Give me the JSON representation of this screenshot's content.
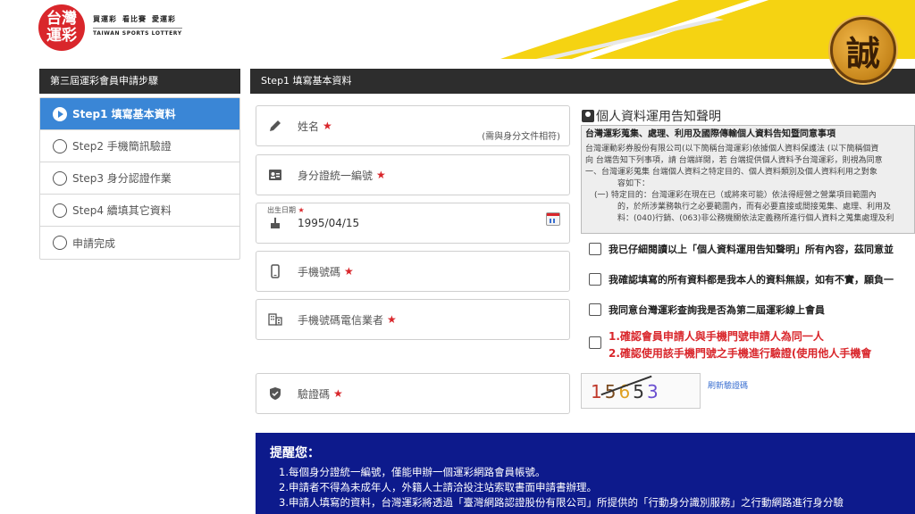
{
  "header": {
    "logo_text": "台灣運彩",
    "slogan": [
      "買運彩",
      "看比賽",
      "愛運彩"
    ],
    "logo_en": "TAIWAN SPORTS LOTTERY",
    "badge": "誠"
  },
  "sidebar": {
    "title": "第三屆運彩會員申請步驟",
    "steps": [
      {
        "label": "Step1 填寫基本資料",
        "active": true
      },
      {
        "label": "Step2 手機簡訊驗證"
      },
      {
        "label": "Step3 身分認證作業"
      },
      {
        "label": "Step4 續填其它資料"
      },
      {
        "label": "申請完成"
      }
    ]
  },
  "main": {
    "title": "Step1 填寫基本資料",
    "fields": {
      "name": {
        "label": "姓名",
        "required": "★",
        "hint": "(需與身分文件相符)"
      },
      "id": {
        "label": "身分證統一編號",
        "required": "★"
      },
      "birthday": {
        "float_label": "出生日期",
        "required": "★",
        "value": "1995/04/15"
      },
      "phone": {
        "label": "手機號碼",
        "required": "★"
      },
      "carrier": {
        "label": "手機號碼電信業者",
        "required": "★"
      },
      "captcha": {
        "label": "驗證碼",
        "required": "★"
      }
    },
    "captcha": {
      "chars": [
        "1",
        "5",
        "6",
        "5",
        "3"
      ],
      "refresh_label": "刷新驗證碼"
    }
  },
  "privacy": {
    "title": "個人資料運用告知聲明",
    "box_title": "台灣運彩蒐集、處理、利用及國際傳輸個人資料告知暨同意事項",
    "lines": [
      "台灣運動彩券股份有限公司(以下簡稱台灣運彩)依據個人資料保護法 (以下簡稱個資",
      "向 台端告知下列事項，請 台端詳閱，若 台端提供個人資料予台灣運彩，則視為同意",
      "一、台灣運彩蒐集 台端個人資料之特定目的、個人資料類別及個人資料利用之對象",
      "容如下：",
      "(一) 特定目的：台灣運彩在現在已（或將來可能）依法得經營之營業項目範圍內",
      "的，於所涉業務執行之必要範圍內，而有必要直接或間接蒐集、處理、利用及",
      "料：(040)行銷、(063)非公務機關依法定義務所進行個人資料之蒐集處理及利"
    ],
    "checks": [
      "我已仔細閱讀以上「個人資料運用告知聲明」所有內容，茲同意並",
      "我確認填寫的所有資料都是我本人的資料無誤，如有不實，願負一",
      "我同意台灣運彩查詢我是否為第二屆運彩線上會員"
    ],
    "red_check": [
      "1.確認會員申請人與手機門號申請人為同一人",
      "2.確認使用該手機門號之手機進行驗證(使用他人手機會"
    ]
  },
  "reminder": {
    "title": "提醒您：",
    "lines": [
      "1.每個身分證統一編號，僅能申辦一個運彩網路會員帳號。",
      "2.申請者不得為未成年人，外籍人士請洽投注站索取書面申請書辦理。",
      "3.申請人填寫的資料，台灣運彩將透過「臺灣網路認證股份有限公司」所提供的「行動身分識別服務」之行動網路進行身分驗"
    ]
  },
  "colors": {
    "accent_blue": "#3a86d6",
    "header_dark": "#2d2d2d",
    "required_red": "#d9262b",
    "reminder_bg": "#0d1a8c",
    "stripe_yellow": "#f5d312"
  }
}
